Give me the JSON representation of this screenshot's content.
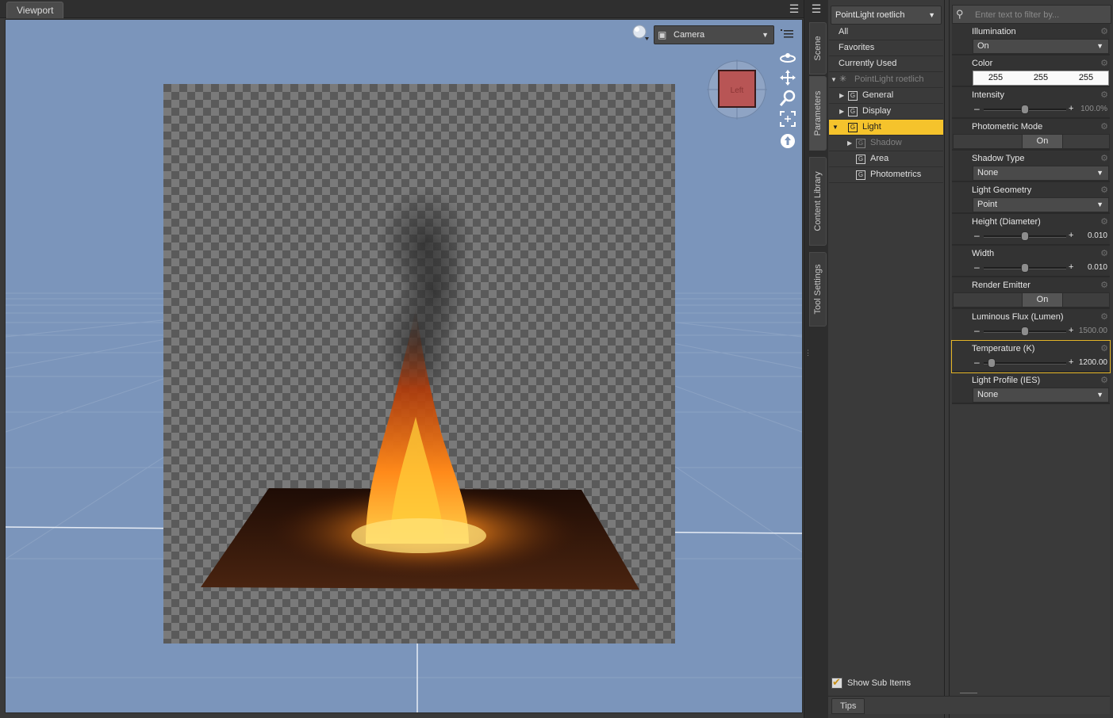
{
  "viewport": {
    "tab_label": "Viewport",
    "camera_label": "Camera",
    "cube_face_label": "Left"
  },
  "side_tabs": [
    "Scene",
    "Parameters",
    "Content Library",
    "Tool Settings"
  ],
  "tree": {
    "node_select": "PointLight roetlich",
    "items": [
      {
        "label": "All"
      },
      {
        "label": "Favorites"
      },
      {
        "label": "Currently Used"
      },
      {
        "label": "PointLight roetlich"
      },
      {
        "label": "General"
      },
      {
        "label": "Display"
      },
      {
        "label": "Light"
      },
      {
        "label": "Shadow"
      },
      {
        "label": "Area"
      },
      {
        "label": "Photometrics"
      }
    ],
    "show_sub_items": "Show Sub Items"
  },
  "params": {
    "filter_placeholder": "Enter text to filter by...",
    "items": [
      {
        "name": "Illumination",
        "value": "On"
      },
      {
        "name": "Color",
        "r": "255",
        "g": "255",
        "b": "255"
      },
      {
        "name": "Intensity",
        "value": "100.0%",
        "fraction": 0.5
      },
      {
        "name": "Photometric Mode",
        "value": "On"
      },
      {
        "name": "Shadow Type",
        "value": "None"
      },
      {
        "name": "Light Geometry",
        "value": "Point"
      },
      {
        "name": "Height (Diameter)",
        "value": "0.010",
        "fraction": 0.5
      },
      {
        "name": "Width",
        "value": "0.010",
        "fraction": 0.5
      },
      {
        "name": "Render Emitter",
        "value": "On"
      },
      {
        "name": "Luminous Flux (Lumen)",
        "value": "1500.00",
        "fraction": 0.5
      },
      {
        "name": "Temperature (K)",
        "value": "1200.00",
        "fraction": 0.1
      },
      {
        "name": "Light Profile (IES)",
        "value": "None"
      }
    ]
  },
  "bottom": {
    "tips_label": "Tips"
  },
  "colors": {
    "selection": "#f5c32c",
    "viewport_bg": "#7b95bb",
    "fire": "#ff8a1a"
  }
}
